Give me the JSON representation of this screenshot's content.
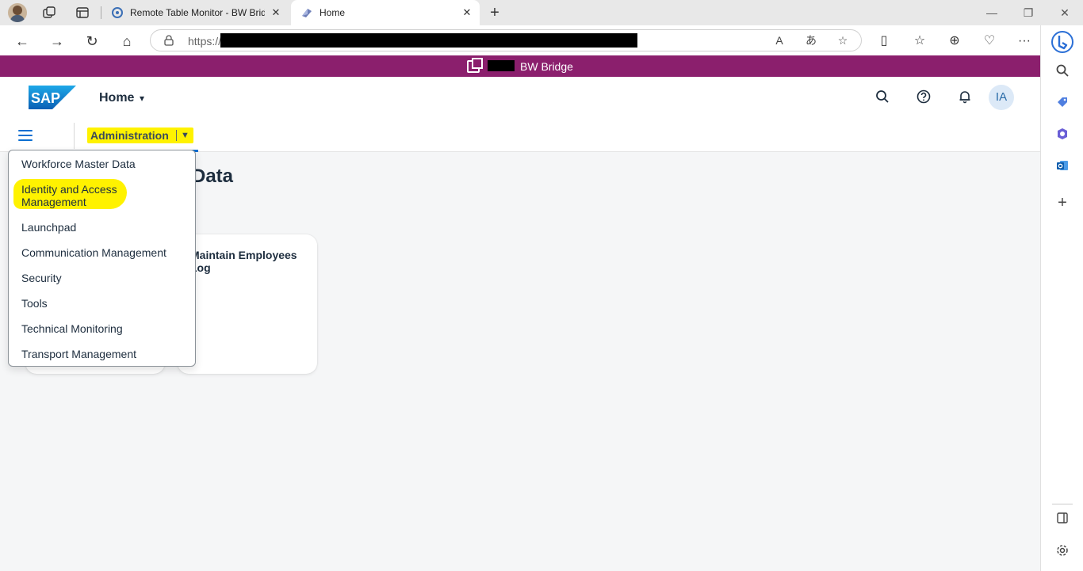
{
  "browser": {
    "tabs": [
      {
        "title": "Remote Table Monitor - BW Bridge",
        "active": false
      },
      {
        "title": "Home",
        "active": true
      }
    ],
    "url_prefix": "https://",
    "icons": {
      "workspaces": "workspaces-icon",
      "tab_actions": "tab-actions-icon",
      "new_tab": "+",
      "minimize": "—",
      "restore": "❐",
      "close": "✕"
    },
    "nav": {
      "back": "←",
      "forward": "→",
      "refresh": "↻",
      "home": "⌂"
    },
    "url_actions": {
      "read_aloud": "A",
      "translate": "あ",
      "favorite": "☆"
    },
    "tools": {
      "split": "▯",
      "favorites": "☆",
      "collections": "⊕",
      "performance": "♡",
      "more": "···"
    }
  },
  "edge_sidebar": {
    "items": [
      "bing-icon",
      "search-icon",
      "shopping-icon",
      "office-icon",
      "outlook-icon",
      "add-icon"
    ],
    "bottom": [
      "sidebar-toggle-icon",
      "settings-icon"
    ]
  },
  "system_bar": {
    "name": "BW Bridge"
  },
  "shell": {
    "logo": "SAP",
    "title": "Home",
    "avatar_initials": "IA"
  },
  "subbar": {
    "space_label": "Administration"
  },
  "page": {
    "heading_fragment": "Data",
    "tiles": [
      {
        "title": ""
      },
      {
        "title": "Maintain Employees Log"
      }
    ]
  },
  "menu": {
    "items": [
      {
        "label": "Workforce Master Data"
      },
      {
        "label": "Identity and Access Management",
        "highlighted": true
      },
      {
        "label": "Launchpad"
      },
      {
        "label": "Communication Management"
      },
      {
        "label": "Security"
      },
      {
        "label": "Tools"
      },
      {
        "label": "Technical Monitoring"
      },
      {
        "label": "Transport Management"
      }
    ]
  },
  "colors": {
    "system_bar": "#8b1f6d",
    "accent": "#0a6ed1",
    "highlight": "#fff200",
    "text": "#1d2d3e"
  }
}
